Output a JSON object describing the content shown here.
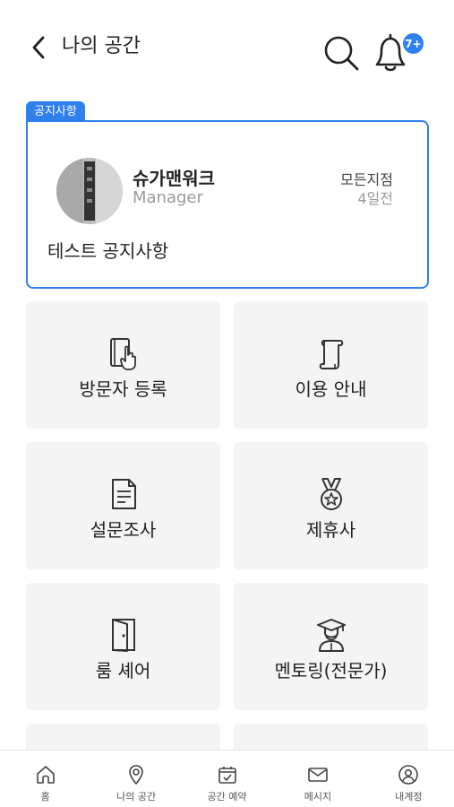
{
  "header": {
    "title": "나의 공간",
    "back_icon": "chevron-left-icon",
    "search_icon": "search-icon",
    "bell_icon": "bell-icon",
    "notification_badge": "7+"
  },
  "notice": {
    "tag": "공지사항",
    "author_name": "슈가맨워크",
    "author_role": "Manager",
    "branch": "모든지점",
    "time_ago": "4일전",
    "text": "테스트 공지사항"
  },
  "menu": [
    {
      "label": "방문자 등록",
      "icon": "visitor-register-icon"
    },
    {
      "label": "이용 안내",
      "icon": "scroll-icon"
    },
    {
      "label": "설문조사",
      "icon": "survey-icon"
    },
    {
      "label": "제휴사",
      "icon": "medal-icon"
    },
    {
      "label": "룸 셰어",
      "icon": "door-icon"
    },
    {
      "label": "멘토링(전문가)",
      "icon": "graduate-icon"
    }
  ],
  "bottom_nav": [
    {
      "label": "홈",
      "icon": "home-icon"
    },
    {
      "label": "나의 공간",
      "icon": "location-pin-icon"
    },
    {
      "label": "공간 예약",
      "icon": "calendar-check-icon"
    },
    {
      "label": "메시지",
      "icon": "mail-icon"
    },
    {
      "label": "내계정",
      "icon": "user-icon"
    }
  ],
  "colors": {
    "accent": "#2f80ed",
    "tile_bg": "#f4f4f4"
  }
}
